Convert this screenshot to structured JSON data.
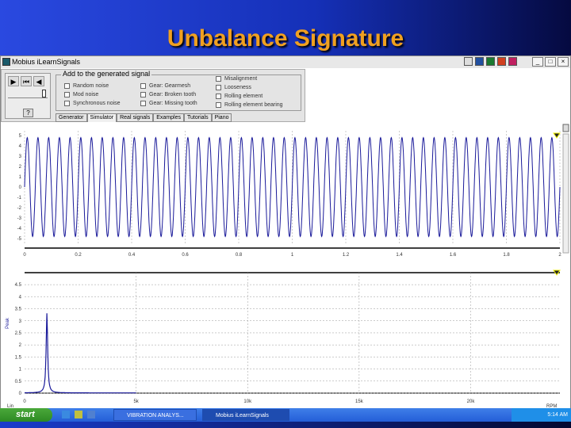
{
  "slide_title": "Unbalance Signature",
  "window": {
    "title": "Mobius iLearnSignals"
  },
  "controls": {
    "play": "▶",
    "rewind": "⏮",
    "sound": "◀",
    "help": "?",
    "group_label": "Add to the generated signal",
    "checkboxes": [
      [
        "Random noise",
        "Mod noise",
        "Synchronous noise"
      ],
      [
        "Gear: Gearmesh",
        "Gear: Broken tooth",
        "Gear: Missing tooth"
      ],
      [
        "Misalignment",
        "Looseness",
        "Rolling element",
        "Rolling element bearing"
      ]
    ],
    "tabs": [
      "Generator",
      "Simulator",
      "Real signals",
      "Examples",
      "Tutorials",
      "Piano"
    ],
    "active_tab": "Simulator"
  },
  "chart_data": [
    {
      "type": "line",
      "title": "Time waveform",
      "x_ticks": [
        "0",
        "0.2",
        "0.4",
        "0.6",
        "0.8",
        "1",
        "1.2",
        "1.4",
        "1.6",
        "1.8",
        "2"
      ],
      "y_ticks": [
        "5",
        "4",
        "3",
        "2",
        "1",
        "0",
        "-1",
        "-2",
        "-3",
        "-4",
        "-5"
      ],
      "xlim": [
        0,
        2
      ],
      "ylim": [
        -5,
        5
      ],
      "signal": {
        "amplitude": 4.8,
        "frequency_hz": 25
      }
    },
    {
      "type": "line",
      "title": "Spectrum",
      "ylabel": "Peak",
      "xlabel": "RPM",
      "x_unit_left": "Lin",
      "x_ticks": [
        "0",
        "5k",
        "10k",
        "15k",
        "20k"
      ],
      "y_ticks": [
        "4.5",
        "4",
        "3.5",
        "3",
        "2.5",
        "2",
        "1.5",
        "1",
        "0.5",
        "0"
      ],
      "xlim": [
        0,
        24000
      ],
      "ylim": [
        0,
        4.8
      ],
      "peak": {
        "rpm": 1000,
        "value": 3.3
      }
    }
  ],
  "taskbar": {
    "start": "start",
    "tasks": [
      "VIBRATION ANALYS...",
      "Mobius iLearnSignals"
    ],
    "clock": "5:14 AM"
  }
}
